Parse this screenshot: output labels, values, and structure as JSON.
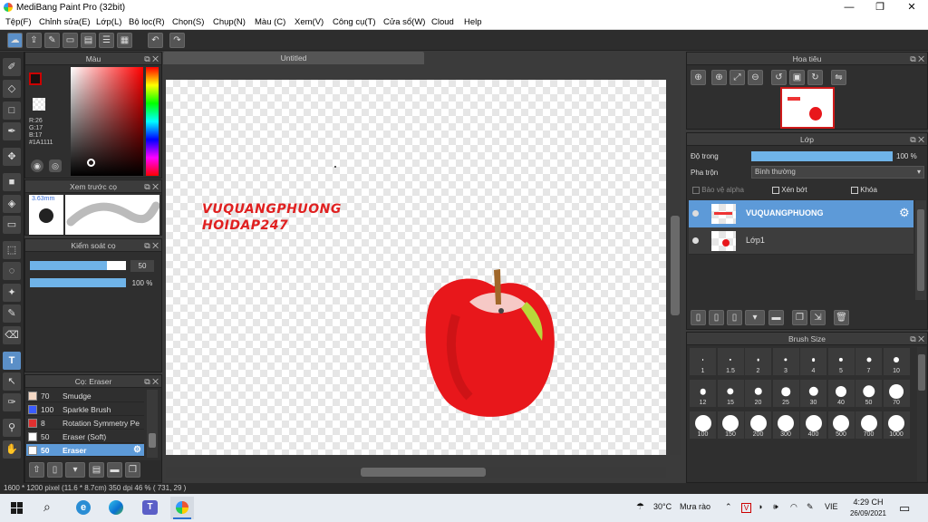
{
  "window": {
    "title": "MediBang Paint Pro (32bit)",
    "min": "—",
    "max": "❐",
    "close": "✕"
  },
  "menu": [
    "Tệp(F)",
    "Chỉnh sửa(E)",
    "Lớp(L)",
    "Bộ lọc(R)",
    "Chọn(S)",
    "Chụp(N)",
    "Màu (C)",
    "Xem(V)",
    "Công cụ(T)",
    "Cửa sổ(W)",
    "Cloud",
    "Help"
  ],
  "color_panel": {
    "title": "Màu",
    "r": "R:26",
    "g": "G:17",
    "b": "B:17",
    "hex": "#1A1111"
  },
  "brush_preview": {
    "title": "Xem trước cọ",
    "size": "3.63mm"
  },
  "brush_control": {
    "title": "Kiểm soát cọ",
    "size_value": "50",
    "size_fill": 0.8,
    "opacity_value": "100 %",
    "opacity_fill": 1.0
  },
  "brush_list": {
    "title": "Cọ: Eraser",
    "items": [
      {
        "size": "70",
        "name": "Smudge",
        "color": "#f4d8c4",
        "selected": false
      },
      {
        "size": "100",
        "name": "Sparkle Brush",
        "color": "#3a5cff",
        "selected": false
      },
      {
        "size": "8",
        "name": "Rotation Symmetry Pe",
        "color": "#e03030",
        "selected": false
      },
      {
        "size": "50",
        "name": "Eraser (Soft)",
        "color": "#ffffff",
        "selected": false
      },
      {
        "size": "50",
        "name": "Eraser",
        "color": "#ffffff",
        "selected": true
      }
    ]
  },
  "canvas": {
    "tab": "Untitled",
    "watermark_line1": "VUQUANGPHUONG",
    "watermark_line2": "HOIDAP247"
  },
  "navigator": {
    "title": "Hoa tiêu"
  },
  "layers": {
    "title": "Lớp",
    "opacity_label": "Độ trong",
    "opacity_value": "100 %",
    "opacity_fill": 1.0,
    "blend_label": "Pha trộn",
    "blend_value": "Bình thường",
    "protect_alpha": "Bảo vệ alpha",
    "clip": "Xén bớt",
    "lock": "Khóa",
    "items": [
      {
        "name": "VUQUANGPHUONG",
        "selected": true
      },
      {
        "name": "Lớp1",
        "selected": false
      }
    ]
  },
  "brush_size": {
    "title": "Brush Size",
    "sizes": [
      "1",
      "1.5",
      "2",
      "3",
      "4",
      "5",
      "7",
      "10",
      "12",
      "15",
      "20",
      "25",
      "30",
      "40",
      "50",
      "70",
      "100",
      "150",
      "200",
      "300",
      "400",
      "500",
      "700",
      "1000"
    ]
  },
  "status": {
    "text": "1600 * 1200 pixel   (11.6 * 8.7cm)   350 dpi   46 %   ( 731, 29 )"
  },
  "taskbar": {
    "weather_temp": "30°C",
    "weather_text": "Mưa rào",
    "lang": "VIE",
    "time": "4:29 CH",
    "date": "26/09/2021"
  }
}
